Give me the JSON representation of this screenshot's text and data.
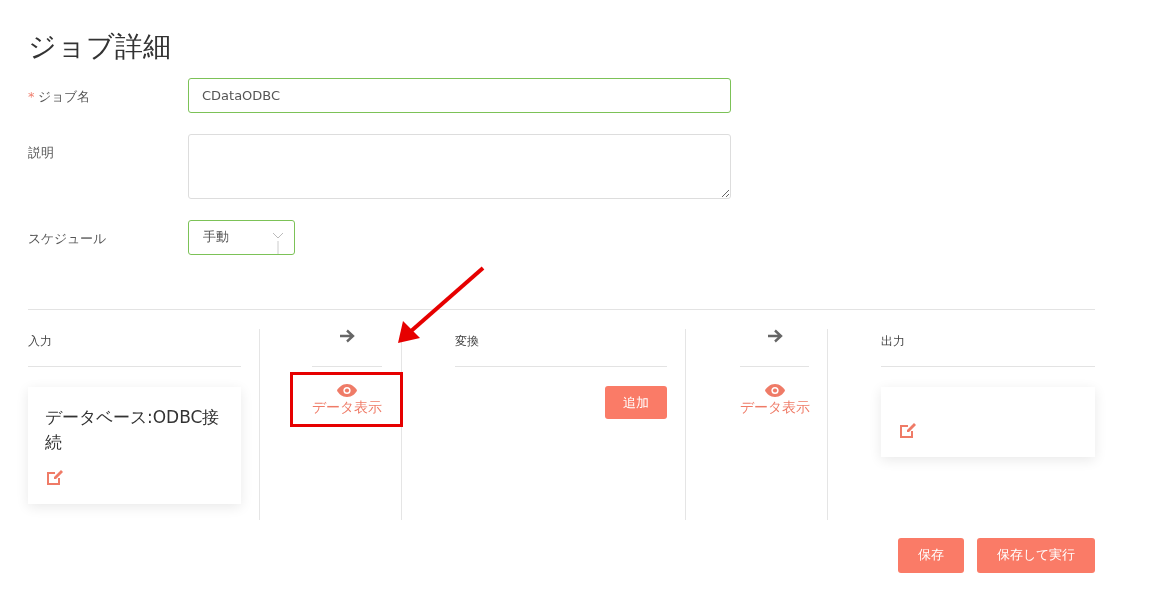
{
  "title": "ジョブ詳細",
  "form": [
    {
      "kind": "text",
      "label": "ジョブ名",
      "required_mark": "*",
      "value": "CDataODBC",
      "focused": true
    },
    {
      "kind": "textarea",
      "label": "説明",
      "focused": false
    },
    {
      "kind": "select",
      "label": "スケジュール",
      "value": "手動",
      "focused": true
    }
  ],
  "pipeline": [
    {
      "kind": "stage",
      "heading": "入力",
      "body": {
        "kind": "card",
        "title": "データベース:ODBC接続"
      }
    },
    {
      "kind": "link",
      "label": "データ表示",
      "highlighted": true
    },
    {
      "kind": "stage",
      "heading": "変換",
      "body": {
        "kind": "button",
        "label": "追加"
      }
    },
    {
      "kind": "link",
      "label": "データ表示",
      "highlighted": false
    },
    {
      "kind": "stage",
      "heading": "出力",
      "body": {
        "kind": "card"
      }
    }
  ],
  "buttons": [
    {
      "label": "保存"
    },
    {
      "label": "保存して実行"
    }
  ]
}
